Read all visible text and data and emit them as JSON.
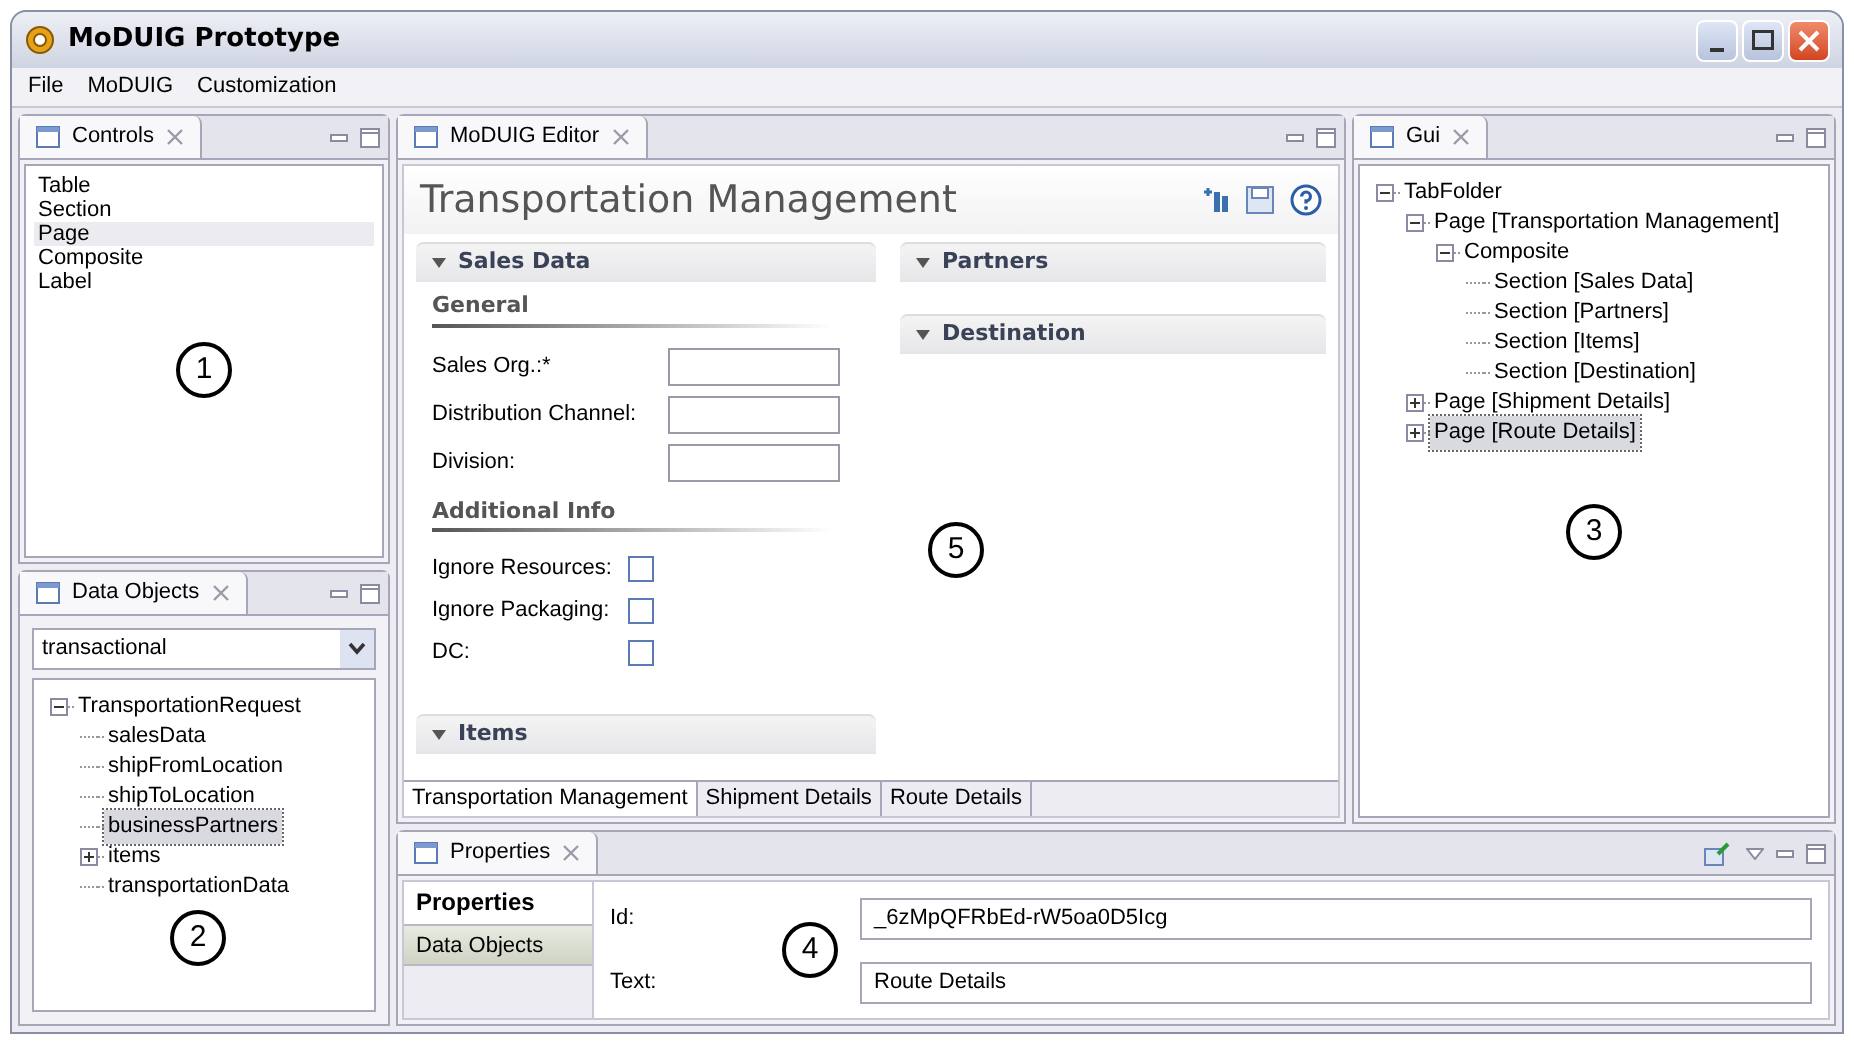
{
  "window": {
    "title": "MoDUIG Prototype"
  },
  "menu": [
    "File",
    "MoDUIG",
    "Customization"
  ],
  "controls_view": {
    "tab": "Controls",
    "callout": "1",
    "items": [
      {
        "label": "Table",
        "selected": false
      },
      {
        "label": "Section",
        "selected": false
      },
      {
        "label": "Page",
        "selected": true
      },
      {
        "label": "Composite",
        "selected": false
      },
      {
        "label": "Label",
        "selected": false
      }
    ]
  },
  "data_objects_view": {
    "tab": "Data Objects",
    "dropdown": "transactional",
    "callout": "2",
    "tree": [
      {
        "label": "TransportationRequest",
        "selected": false,
        "expanded": true,
        "children": [
          {
            "label": "salesData",
            "selected": false
          },
          {
            "label": "shipFromLocation",
            "selected": false
          },
          {
            "label": "shipToLocation",
            "selected": false
          },
          {
            "label": "businessPartners",
            "selected": true
          },
          {
            "label": "items",
            "selected": false,
            "expanded": false
          },
          {
            "label": "transportationData",
            "selected": false
          }
        ]
      }
    ]
  },
  "editor": {
    "tab": "MoDUIG Editor",
    "title": "Transportation Management",
    "callout": "5",
    "left_sections": [
      {
        "title": "Sales Data",
        "expanded": true,
        "groups": [
          {
            "title": "General",
            "kind": "fields",
            "items": [
              {
                "label": "Sales Org.:*"
              },
              {
                "label": "Distribution Channel:"
              },
              {
                "label": "Division:"
              }
            ]
          },
          {
            "title": "Additional Info",
            "kind": "checkboxes",
            "items": [
              {
                "label": "Ignore Resources:",
                "checked": false
              },
              {
                "label": "Ignore Packaging:",
                "checked": false
              },
              {
                "label": "DC:",
                "checked": false
              }
            ]
          }
        ]
      },
      {
        "title": "Items",
        "expanded": true
      }
    ],
    "right_sections": [
      {
        "title": "Partners",
        "expanded": true
      },
      {
        "title": "Destination",
        "expanded": true
      }
    ],
    "page_tabs": [
      {
        "label": "Transportation Management",
        "selected": true
      },
      {
        "label": "Shipment Details",
        "selected": false
      },
      {
        "label": "Route Details",
        "selected": false
      }
    ]
  },
  "gui_view": {
    "tab": "Gui",
    "callout": "3",
    "tree": [
      {
        "label": "TabFolder",
        "selected": false,
        "expanded": true,
        "children": [
          {
            "label": "Page [Transportation Management]",
            "selected": false,
            "expanded": true,
            "children": [
              {
                "label": "Composite",
                "selected": false,
                "expanded": true,
                "children": [
                  {
                    "label": "Section [Sales Data]",
                    "selected": false
                  },
                  {
                    "label": "Section [Partners]",
                    "selected": false
                  },
                  {
                    "label": "Section [Items]",
                    "selected": false
                  },
                  {
                    "label": "Section [Destination]",
                    "selected": false
                  }
                ]
              }
            ]
          },
          {
            "label": "Page [Shipment Details]",
            "selected": false,
            "expanded": false
          },
          {
            "label": "Page [Route Details]",
            "selected": true,
            "expanded": false
          }
        ]
      }
    ]
  },
  "properties_view": {
    "tab": "Properties",
    "callout": "4",
    "side_tabs": [
      {
        "label": "Properties",
        "selected": true
      },
      {
        "label": "Data Objects",
        "selected": false
      }
    ],
    "fields": [
      {
        "label": "Id:",
        "value": "_6zMpQFRbEd-rW5oa0D5Icg"
      },
      {
        "label": "Text:",
        "value": "Route Details"
      }
    ]
  }
}
